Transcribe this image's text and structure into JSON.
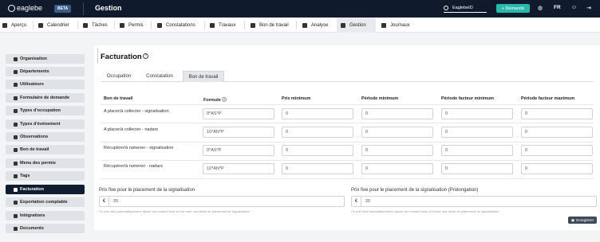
{
  "topbar": {
    "logo": "eaglebe",
    "beta": "BETA",
    "title": "Gestion",
    "search_value": "EaglebeID",
    "new_button": "+ Demande",
    "lang": "FR",
    "icons": [
      "globe-icon",
      "user-icon",
      "logout-icon"
    ]
  },
  "nav": {
    "items": [
      {
        "label": "Aperçu",
        "icon": "gauge-icon"
      },
      {
        "label": "Calendrier",
        "icon": "calendar-icon"
      },
      {
        "label": "Tâches",
        "icon": "list-icon"
      },
      {
        "label": "Permis",
        "icon": "truck-icon"
      },
      {
        "label": "Constatations",
        "icon": "eye-icon"
      },
      {
        "label": "Travaux",
        "icon": "truck-icon"
      },
      {
        "label": "Bon de travail",
        "icon": "file-icon"
      },
      {
        "label": "Analyse",
        "icon": "compass-icon"
      },
      {
        "label": "Gestion",
        "icon": "cogs-icon"
      },
      {
        "label": "Journaux",
        "icon": "history-icon"
      }
    ]
  },
  "sidebar": {
    "items": [
      {
        "label": "Organisation"
      },
      {
        "label": "Départements"
      },
      {
        "label": "Utilisateurs"
      },
      {
        "label": "Formulaire de demande"
      },
      {
        "label": "Types d'occupation"
      },
      {
        "label": "Types d'événement"
      },
      {
        "label": "Observations"
      },
      {
        "label": "Bon de travail"
      },
      {
        "label": "Menu des permis"
      },
      {
        "label": "Tags"
      },
      {
        "label": "Facturation"
      },
      {
        "label": "Exportation comptable"
      },
      {
        "label": "Intégrations"
      },
      {
        "label": "Documents"
      }
    ]
  },
  "page": {
    "title": "Facturation",
    "tabs": [
      "Occupation",
      "Constatation",
      "Bon de travail"
    ],
    "table": {
      "headers": [
        "Bon de travail",
        "Formule",
        "Prix minimum",
        "Période minimum",
        "Période facteur minimum",
        "Période facteur maximum"
      ],
      "rows": [
        {
          "label": "A placer/à collecter - signalisation",
          "formula": "0*AS*P",
          "values": [
            "0",
            "0",
            "0",
            "0"
          ]
        },
        {
          "label": "A placer/à collecter - nadars",
          "formula": "10*AN*P",
          "values": [
            "0",
            "0",
            "0",
            "0"
          ]
        },
        {
          "label": "Récupérer/à ramener - signalisation",
          "formula": "0*AS*P",
          "values": [
            "0",
            "0",
            "0",
            "0"
          ]
        },
        {
          "label": "Récupérer/à ramener - nadars",
          "formula": "10*AN*P",
          "values": [
            "0",
            "0",
            "0",
            "0"
          ]
        }
      ]
    },
    "fixed_price": {
      "label": "Prix fixe pour le placement de la signalisation",
      "currency": "€",
      "value": "20",
      "hint": "Ce prix sera automatiquement ajouté au montant total s'il est créé une tâche de placement de signalisation."
    },
    "fixed_price_ext": {
      "label": "Prix fixe pour le placement de la signalisation (Prolongation)",
      "currency": "€",
      "value": "20",
      "hint": "Ce prix sera automatiquement ajouté au montant total s'il existe une tâche de placement de signalisation."
    },
    "save_button": "Enregistrer"
  }
}
